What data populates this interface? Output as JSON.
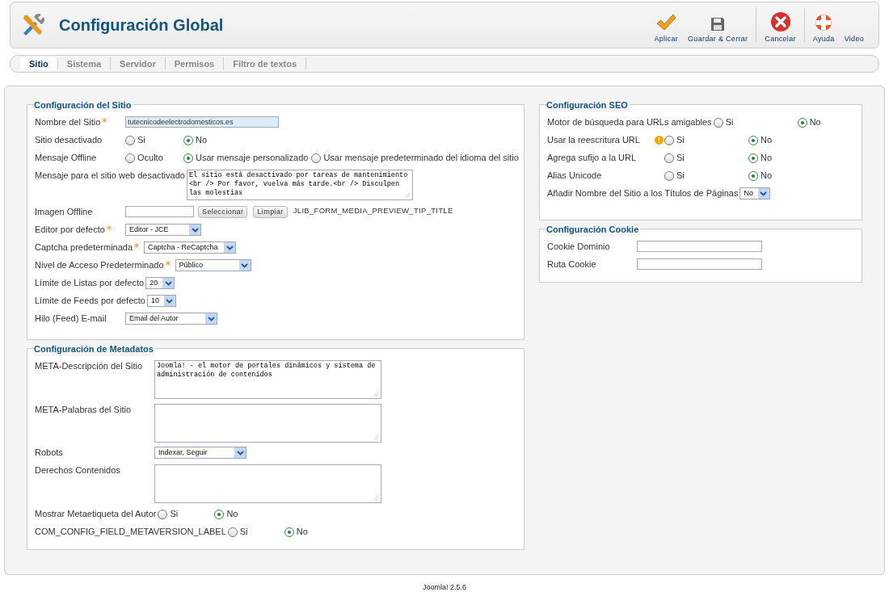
{
  "header": {
    "title": "Configuración Global"
  },
  "toolbar": [
    {
      "kind": "apply",
      "label": "Aplicar"
    },
    {
      "kind": "save",
      "label": "Guardar & Cerrar"
    },
    {
      "kind": "cancel",
      "label": "Cancelar"
    },
    {
      "kind": "help",
      "label": "Ayuda"
    },
    {
      "kind": "video",
      "label": "Video"
    }
  ],
  "tabs": [
    {
      "label": "Sitio",
      "selected": true
    },
    {
      "label": "Sistema",
      "selected": false
    },
    {
      "label": "Servidor",
      "selected": false
    },
    {
      "label": "Permisos",
      "selected": false
    },
    {
      "label": "Filtro de textos",
      "selected": false
    }
  ],
  "left_panels": [
    {
      "title": "Configuración del Sitio",
      "fields": [
        {
          "kind": "text",
          "label": "Nombre del Sitio",
          "required": true,
          "value": "tutecnicodeelectrodomesticos.es"
        },
        {
          "kind": "radio",
          "label": "Sitio desactivado",
          "options": [
            {
              "label": "Si",
              "selected": false
            },
            {
              "label": "No",
              "selected": true
            }
          ]
        },
        {
          "kind": "radio",
          "label": "Mensaje Offline",
          "options": [
            {
              "label": "Oculto",
              "selected": false
            },
            {
              "label": "Usar mensaje personalizado",
              "selected": true
            },
            {
              "label": "Usar mensaje predeterminado del idioma del sitio",
              "selected": false
            }
          ]
        },
        {
          "kind": "textarea",
          "label": "Mensaje para el sitio web desactivado",
          "value": "El sitio está desactivado por tareas de mantenimiento <br /> Por favor, vuelva más tarde.<br /> Disculpen las molestias"
        },
        {
          "kind": "media",
          "label": "Imagen Offline",
          "buttons": [
            "Seleccionar",
            "Limpiar"
          ],
          "preview": "JLIB_FORM_MEDIA_PREVIEW_TIP_TITLE"
        },
        {
          "kind": "select",
          "label": "Editor por defecto",
          "required": true,
          "value": "Editor - JCE"
        },
        {
          "kind": "select",
          "label": "Captcha predeterminada",
          "required": true,
          "value": "Captcha - ReCaptcha"
        },
        {
          "kind": "select",
          "label": "Nivel de Acceso Predeterminado",
          "required": true,
          "value": "Público"
        },
        {
          "kind": "select",
          "label": "Límite de Listas por defecto",
          "value": "20"
        },
        {
          "kind": "select",
          "label": "Límite de Feeds por defecto",
          "value": "10"
        },
        {
          "kind": "select",
          "label": "Hilo (Feed) E-mail",
          "value": "Email del Autor"
        }
      ]
    },
    {
      "title": "Configuración de Metadatos",
      "fields": [
        {
          "kind": "textarea",
          "label": "META-Descripción del Sitio",
          "value": "Joomla! - el motor de portales dinámicos y sistema de administración de contenidos"
        },
        {
          "kind": "textarea",
          "label": "META-Palabras del Sitio"
        },
        {
          "kind": "select",
          "label": "Robots",
          "value": "Indexar, Seguir"
        },
        {
          "kind": "textarea",
          "label": "Derechos Contenidos"
        },
        {
          "kind": "radio",
          "label": "Mostrar Metaetiqueta del Autor",
          "options": [
            {
              "label": "Si",
              "selected": false
            },
            {
              "label": "No",
              "selected": true
            }
          ]
        },
        {
          "kind": "radio",
          "label": "COM_CONFIG_FIELD_METAVERSION_LABEL",
          "options": [
            {
              "label": "Si",
              "selected": false
            },
            {
              "label": "No",
              "selected": true
            }
          ]
        }
      ]
    }
  ],
  "right_panels": [
    {
      "title": "Configuración SEO",
      "fields": [
        {
          "kind": "radio",
          "label": "Motor de búsqueda para URLs amigables",
          "options": [
            {
              "label": "Si",
              "selected": false
            },
            {
              "label": "No",
              "selected": true
            }
          ]
        },
        {
          "kind": "radio",
          "label": "Usar la reescritura URL",
          "warning": true,
          "options": [
            {
              "label": "Si",
              "selected": false
            },
            {
              "label": "No",
              "selected": true
            }
          ]
        },
        {
          "kind": "radio",
          "label": "Agrega sufijo a la URL",
          "options": [
            {
              "label": "Si",
              "selected": false
            },
            {
              "label": "No",
              "selected": true
            }
          ]
        },
        {
          "kind": "radio",
          "label": "Alias Unicode",
          "options": [
            {
              "label": "Si",
              "selected": false
            },
            {
              "label": "No",
              "selected": true
            }
          ]
        },
        {
          "kind": "select",
          "label": "Añadir Nombre del Sitio a los Títulos de Páginas",
          "value": "No"
        }
      ]
    },
    {
      "title": "Configuración Cookie",
      "fields": [
        {
          "kind": "text",
          "label": "Cookie Dominio"
        },
        {
          "kind": "text",
          "label": "Ruta Cookie"
        }
      ]
    }
  ],
  "footer": "Joomla! 2.5.6"
}
